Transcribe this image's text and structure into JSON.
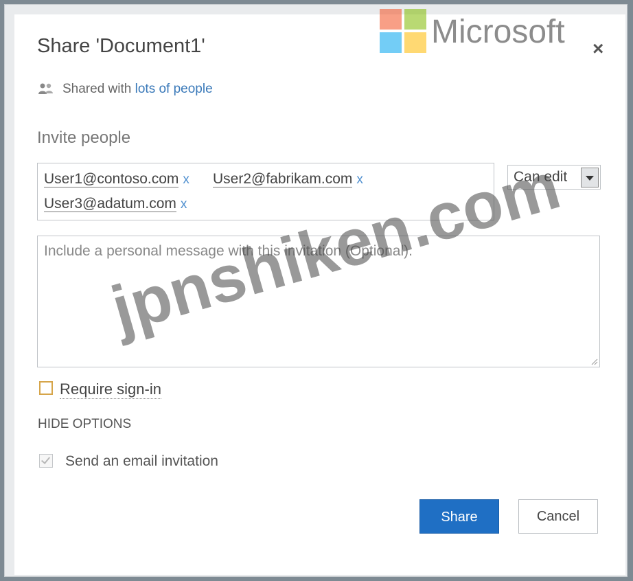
{
  "dialog": {
    "title": "Share 'Document1'",
    "close_glyph": "×",
    "shared_prefix": "Shared with",
    "shared_link": "lots of people"
  },
  "brand": {
    "name": "Microsoft",
    "logo_colors": [
      "#f25022",
      "#7fba00",
      "#00a4ef",
      "#ffb900"
    ]
  },
  "invite": {
    "label": "Invite people",
    "people": [
      "User1@contoso.com",
      "User2@fabrikam.com",
      "User3@adatum.com"
    ],
    "remove_glyph": "x",
    "permission": "Can edit"
  },
  "message": {
    "placeholder": "Include a personal message with this invitation (Optional)."
  },
  "options": {
    "require_signin_label": "Require sign-in",
    "require_signin_checked": false,
    "hide_options": "HIDE OPTIONS",
    "send_email_label": "Send an email invitation",
    "send_email_checked": true
  },
  "buttons": {
    "share": "Share",
    "cancel": "Cancel"
  },
  "colors": {
    "accent": "#1f6fc4",
    "link": "#3a79b9"
  },
  "watermark": "jpnshiken.com"
}
